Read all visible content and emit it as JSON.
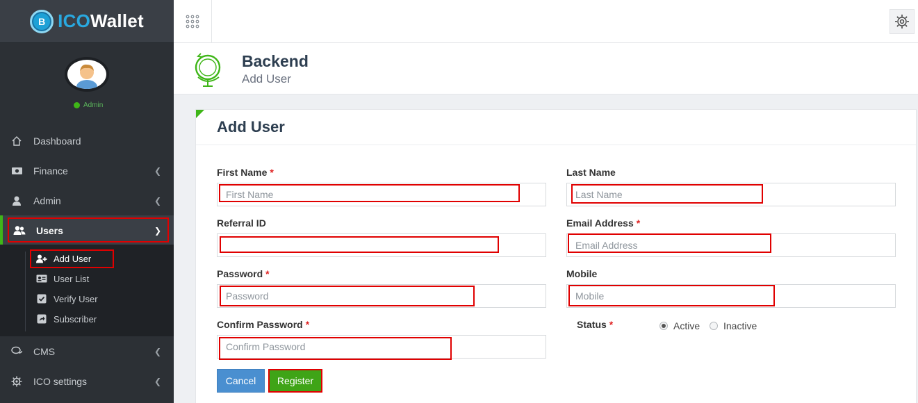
{
  "brand": {
    "logo_letter": "B",
    "name_part1": "ICO",
    "name_part2": "Wallet"
  },
  "profile": {
    "role": "Admin"
  },
  "sidebar": {
    "items": [
      {
        "label": "Dashboard",
        "icon": "home-icon"
      },
      {
        "label": "Finance",
        "icon": "money-icon"
      },
      {
        "label": "Admin",
        "icon": "admin-icon"
      },
      {
        "label": "Users",
        "icon": "users-icon",
        "active": true
      },
      {
        "label": "CMS",
        "icon": "chat-icon"
      },
      {
        "label": "ICO settings",
        "icon": "gear-icon"
      }
    ],
    "submenu": [
      {
        "label": "Add User",
        "icon": "add-user-icon",
        "current": true
      },
      {
        "label": "User List",
        "icon": "id-card-icon"
      },
      {
        "label": "Verify User",
        "icon": "check-square-icon"
      },
      {
        "label": "Subscriber",
        "icon": "share-icon"
      }
    ]
  },
  "page_header": {
    "title": "Backend",
    "subtitle": "Add User"
  },
  "form": {
    "title": "Add User",
    "first_name": {
      "label": "First Name",
      "required": "*",
      "placeholder": "First Name",
      "value": ""
    },
    "last_name": {
      "label": "Last Name",
      "placeholder": "Last Name",
      "value": ""
    },
    "referral_id": {
      "label": "Referral ID",
      "placeholder": "",
      "value": ""
    },
    "email": {
      "label": "Email Address",
      "required": "*",
      "placeholder": "Email Address",
      "value": ""
    },
    "password": {
      "label": "Password",
      "required": "*",
      "placeholder": "Password",
      "value": ""
    },
    "mobile": {
      "label": "Mobile",
      "placeholder": "Mobile",
      "value": ""
    },
    "confirm_password": {
      "label": "Confirm Password",
      "required": "*",
      "placeholder": "Confirm Password",
      "value": ""
    },
    "status": {
      "label": "Status",
      "required": "*",
      "options": [
        "Active",
        "Inactive"
      ],
      "selected": "Active"
    },
    "cancel_label": "Cancel",
    "register_label": "Register"
  },
  "colors": {
    "accent_green": "#3fb618",
    "highlight_red": "#e00000",
    "sidebar_bg": "#2c3035",
    "cancel_blue": "#4a8fd0"
  }
}
